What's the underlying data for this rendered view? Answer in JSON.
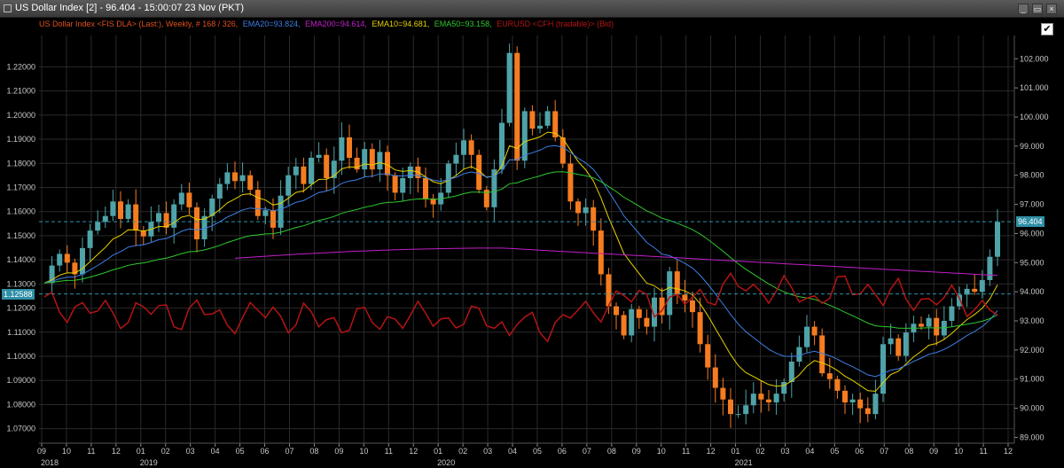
{
  "window": {
    "title": "US Dollar Index [2] - 96.404 - 15:00:07  23 Nov (PKT)",
    "btn_minimize": "_",
    "btn_restore": "▭",
    "btn_close": "×"
  },
  "checkbox_mark": "✔",
  "legend": [
    {
      "text": "US Dollar Index <FIS DLA> (Last:), Weekly, # 168 / 326,",
      "color": "#e0501e"
    },
    {
      "text": "EMA20=93.824,",
      "color": "#3e7fe6"
    },
    {
      "text": "EMA200=94.614,",
      "color": "#c020c8"
    },
    {
      "text": "EMA10=94.681,",
      "color": "#e6d200"
    },
    {
      "text": "EMA50=93.158,",
      "color": "#2ec82e"
    },
    {
      "text": "EURUSD <CFH (tradable)> (Bid)",
      "color": "#b41414"
    }
  ],
  "colors": {
    "up": "#4fa3a8",
    "down": "#f57c20",
    "eurusd": "#b41414",
    "ema10": "#e6d200",
    "ema20": "#3e7fe6",
    "ema50": "#2ec82e",
    "ema200": "#c020c8",
    "grid": "#2a2a2a",
    "dashed": "#2f8fa6",
    "last_tag": "#2f8fa6"
  },
  "tags": {
    "last_price": "96.404",
    "eurusd_level": "1.12588"
  },
  "chart_data": {
    "type": "line",
    "title": "US Dollar Index <FIS DLA> (Last:), Weekly",
    "left_axis_ticks": [
      "1.07000",
      "1.08000",
      "1.09000",
      "1.10000",
      "1.11000",
      "1.12000",
      "1.13000",
      "1.14000",
      "1.15000",
      "1.16000",
      "1.17000",
      "1.18000",
      "1.19000",
      "1.20000",
      "1.21000",
      "1.22000"
    ],
    "right_axis_ticks": [
      "89.000",
      "90.000",
      "91.000",
      "92.000",
      "93.000",
      "94.000",
      "95.000",
      "96.000",
      "97.000",
      "98.000",
      "99.000",
      "100.000",
      "101.000",
      "102.000"
    ],
    "ylim_left": [
      1.064,
      1.233
    ],
    "ylim_right": [
      88.8,
      102.8
    ],
    "x_ticks": [
      {
        "label": "09",
        "year": "2018"
      },
      {
        "label": "10"
      },
      {
        "label": "11"
      },
      {
        "label": "12"
      },
      {
        "label": "01",
        "year": "2019"
      },
      {
        "label": "02"
      },
      {
        "label": "03"
      },
      {
        "label": "04"
      },
      {
        "label": "05"
      },
      {
        "label": "06"
      },
      {
        "label": "07"
      },
      {
        "label": "08"
      },
      {
        "label": "09"
      },
      {
        "label": "10"
      },
      {
        "label": "11"
      },
      {
        "label": "12"
      },
      {
        "label": "01",
        "year": "2020"
      },
      {
        "label": "02"
      },
      {
        "label": "03"
      },
      {
        "label": "04"
      },
      {
        "label": "05"
      },
      {
        "label": "06"
      },
      {
        "label": "07"
      },
      {
        "label": "08"
      },
      {
        "label": "09"
      },
      {
        "label": "10"
      },
      {
        "label": "11"
      },
      {
        "label": "12"
      },
      {
        "label": "01",
        "year": "2021"
      },
      {
        "label": "02"
      },
      {
        "label": "03"
      },
      {
        "label": "04"
      },
      {
        "label": "05"
      },
      {
        "label": "06"
      },
      {
        "label": "07"
      },
      {
        "label": "08"
      },
      {
        "label": "09"
      },
      {
        "label": "10"
      },
      {
        "label": "11"
      },
      {
        "label": "12"
      }
    ],
    "last_price": 96.404,
    "eurusd_level": 1.12588,
    "dxy_close": [
      94.3,
      94.9,
      95.3,
      95.0,
      94.6,
      95.5,
      96.1,
      96.4,
      96.6,
      97.1,
      96.5,
      97.0,
      96.1,
      95.9,
      96.4,
      96.7,
      96.2,
      97.0,
      97.4,
      96.9,
      95.8,
      96.6,
      97.2,
      97.7,
      98.1,
      97.8,
      98.0,
      97.5,
      96.6,
      96.8,
      96.2,
      97.3,
      98.0,
      98.3,
      97.7,
      98.6,
      98.7,
      97.9,
      98.5,
      99.3,
      98.6,
      98.2,
      98.9,
      98.2,
      98.8,
      98.0,
      97.4,
      97.9,
      98.3,
      97.9,
      97.2,
      97.0,
      97.4,
      98.4,
      98.7,
      99.2,
      98.7,
      97.5,
      96.9,
      98.2,
      99.8,
      102.2,
      98.5,
      100.2,
      99.6,
      99.7,
      100.2,
      99.3,
      98.4,
      97.1,
      96.7,
      96.9,
      96.1,
      94.6,
      93.5,
      93.2,
      92.5,
      93.4,
      93.1,
      92.8,
      93.8,
      93.2,
      94.7,
      93.9,
      93.7,
      93.3,
      92.2,
      91.4,
      90.7,
      90.3,
      89.8,
      89.8,
      90.1,
      90.5,
      90.3,
      90.2,
      90.5,
      90.9,
      91.6,
      92.1,
      92.8,
      92.5,
      91.2,
      91.0,
      90.6,
      90.2,
      90.3,
      90.0,
      89.8,
      90.5,
      92.2,
      92.4,
      91.8,
      92.6,
      92.9,
      92.8,
      93.1,
      92.5,
      93.0,
      93.5,
      93.9,
      94.1,
      94.0,
      94.4,
      95.2,
      96.4
    ]
  }
}
